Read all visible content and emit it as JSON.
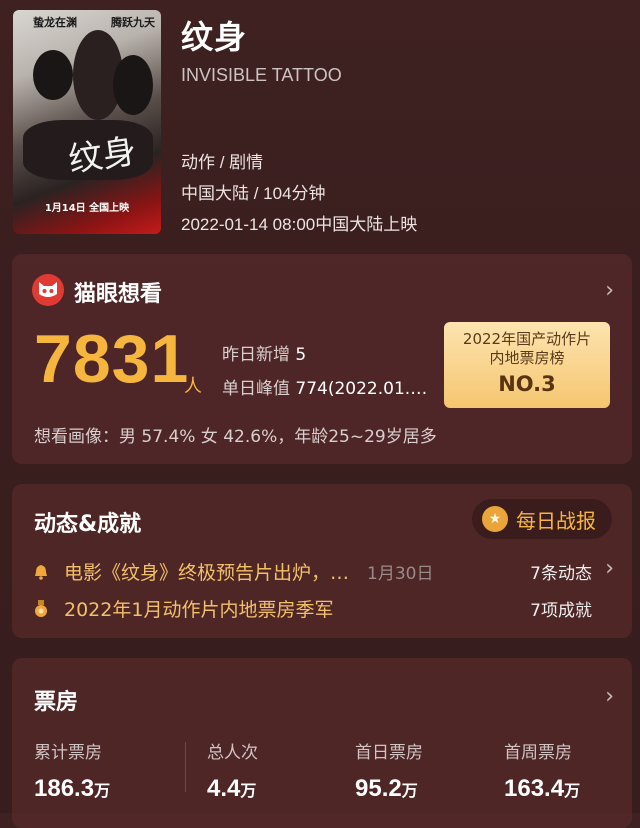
{
  "movie": {
    "title": "纹身",
    "english_title": "INVISIBLE TATTOO",
    "genre": "动作 / 剧情",
    "region_duration": "中国大陆 / 104分钟",
    "release": "2022-01-14 08:00中国大陆上映",
    "poster": {
      "tagline_left": "蛰龙在渊",
      "tagline_right": "腾跃九天",
      "calligraphy": "纹身",
      "release_text": "1月14日 全国上映"
    }
  },
  "want": {
    "title": "猫眼想看",
    "count": "7831",
    "unit": "人",
    "yesterday_label": "昨日新增",
    "yesterday_value": "5",
    "peak_label": "单日峰值",
    "peak_value": "774(2022.01.…",
    "rank_line1": "2022年国产动作片",
    "rank_line2": "内地票房榜",
    "rank_line3": "NO.3",
    "portrait": "想看画像：男 57.4%  女 42.6%，年龄25~29岁居多"
  },
  "news": {
    "title": "动态&成就",
    "daily_button": "每日战报",
    "item1_text": "电影《纹身》终极预告片出炉，…",
    "item1_date": "1月30日",
    "item1_count": "7条动态",
    "item2_text": "2022年1月动作片内地票房季军",
    "item2_count": "7项成就"
  },
  "box_office": {
    "title": "票房",
    "columns": [
      {
        "label": "累计票房",
        "value": "186.3",
        "unit": "万"
      },
      {
        "label": "总人次",
        "value": "4.4",
        "unit": "万"
      },
      {
        "label": "首日票房",
        "value": "95.2",
        "unit": "万"
      },
      {
        "label": "首周票房",
        "value": "163.4",
        "unit": "万"
      }
    ]
  },
  "colors": {
    "accent": "#f6b63e",
    "cat_red": "#e03b33"
  },
  "icons": [
    "chevron-right-icon",
    "cat-logo-icon",
    "bell-icon",
    "medal-icon"
  ]
}
